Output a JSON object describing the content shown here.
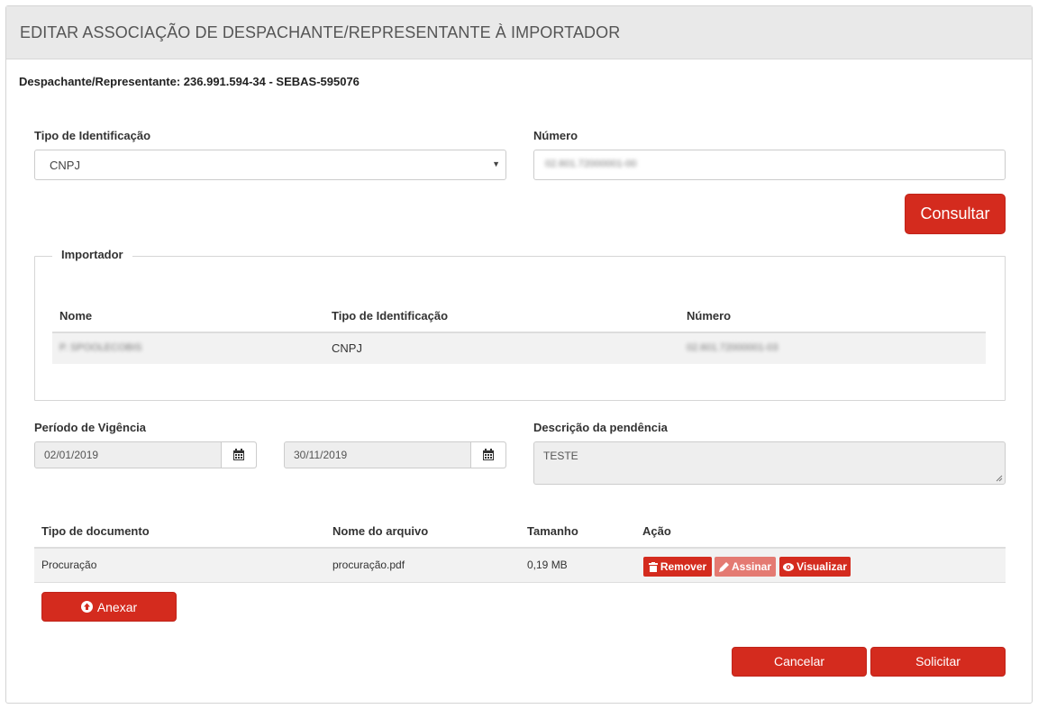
{
  "panel": {
    "title": "EDITAR ASSOCIAÇÃO DE DESPACHANTE/REPRESENTANTE À IMPORTADOR",
    "despachante": "Despachante/Representante: 236.991.594-34 - SEBAS-595076"
  },
  "search": {
    "tipo_label": "Tipo de Identificação",
    "tipo_value": "CNPJ",
    "numero_label": "Número",
    "numero_value": "02.601.72000001-00",
    "consultar_label": "Consultar"
  },
  "importador": {
    "legend": "Importador",
    "columns": [
      "Nome",
      "Tipo de Identificação",
      "Número"
    ],
    "rows": [
      {
        "nome": "P. SPOOLECOBIS",
        "tipo": "CNPJ",
        "numero": "02.601.72000001-03"
      }
    ]
  },
  "vigencia": {
    "label": "Período de Vigência",
    "start": "02/01/2019",
    "end": "30/11/2019"
  },
  "descricao": {
    "label": "Descrição da pendência",
    "value": "TESTE"
  },
  "documents": {
    "columns": [
      "Tipo de documento",
      "Nome do arquivo",
      "Tamanho",
      "Ação"
    ],
    "rows": [
      {
        "tipo": "Procuração",
        "arquivo": "procuração.pdf",
        "tamanho": "0,19 MB",
        "remover": "Remover",
        "assinar": "Assinar",
        "visualizar": "Visualizar"
      }
    ],
    "anexar_label": "Anexar"
  },
  "footer": {
    "cancelar_label": "Cancelar",
    "solicitar_label": "Solicitar"
  },
  "colors": {
    "primary_red": "#d42b1e",
    "disabled_red": "#e47a72",
    "header_gray": "#e9e9e9"
  }
}
